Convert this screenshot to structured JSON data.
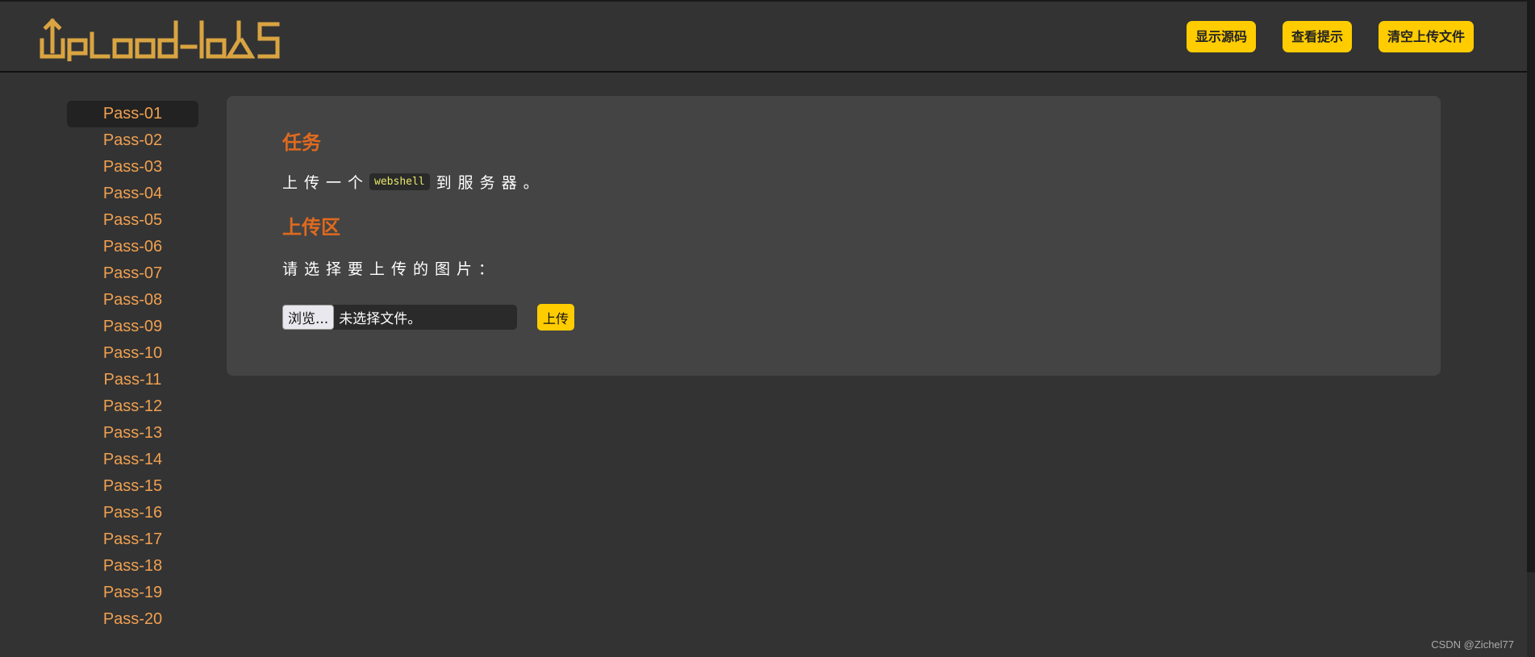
{
  "header": {
    "logo_text": "Upload-labs",
    "actions": [
      {
        "label": "显示源码"
      },
      {
        "label": "查看提示"
      },
      {
        "label": "清空上传文件"
      }
    ]
  },
  "sidebar": {
    "active_index": 0,
    "items": [
      {
        "label": "Pass-01"
      },
      {
        "label": "Pass-02"
      },
      {
        "label": "Pass-03"
      },
      {
        "label": "Pass-04"
      },
      {
        "label": "Pass-05"
      },
      {
        "label": "Pass-06"
      },
      {
        "label": "Pass-07"
      },
      {
        "label": "Pass-08"
      },
      {
        "label": "Pass-09"
      },
      {
        "label": "Pass-10"
      },
      {
        "label": "Pass-11"
      },
      {
        "label": "Pass-12"
      },
      {
        "label": "Pass-13"
      },
      {
        "label": "Pass-14"
      },
      {
        "label": "Pass-15"
      },
      {
        "label": "Pass-16"
      },
      {
        "label": "Pass-17"
      },
      {
        "label": "Pass-18"
      },
      {
        "label": "Pass-19"
      },
      {
        "label": "Pass-20"
      }
    ]
  },
  "main": {
    "task": {
      "title": "任务",
      "text_before": "上传一个",
      "code": "webshell",
      "text_after": "到服务器。"
    },
    "upload": {
      "title": "上传区",
      "prompt": "请选择要上传的图片：",
      "browse_label": "浏览...",
      "file_status": "未选择文件。",
      "submit_label": "上传"
    }
  },
  "footer": {
    "credit": "CSDN @Zichel77"
  },
  "colors": {
    "background": "#333333",
    "panel": "#444444",
    "accent_yellow": "#ffcc00",
    "heading_orange": "#e06a1e",
    "link_orange": "#f0a050",
    "logo_gold": "#d9a441"
  },
  "icons": {
    "logo": "upload-labs-logo"
  }
}
